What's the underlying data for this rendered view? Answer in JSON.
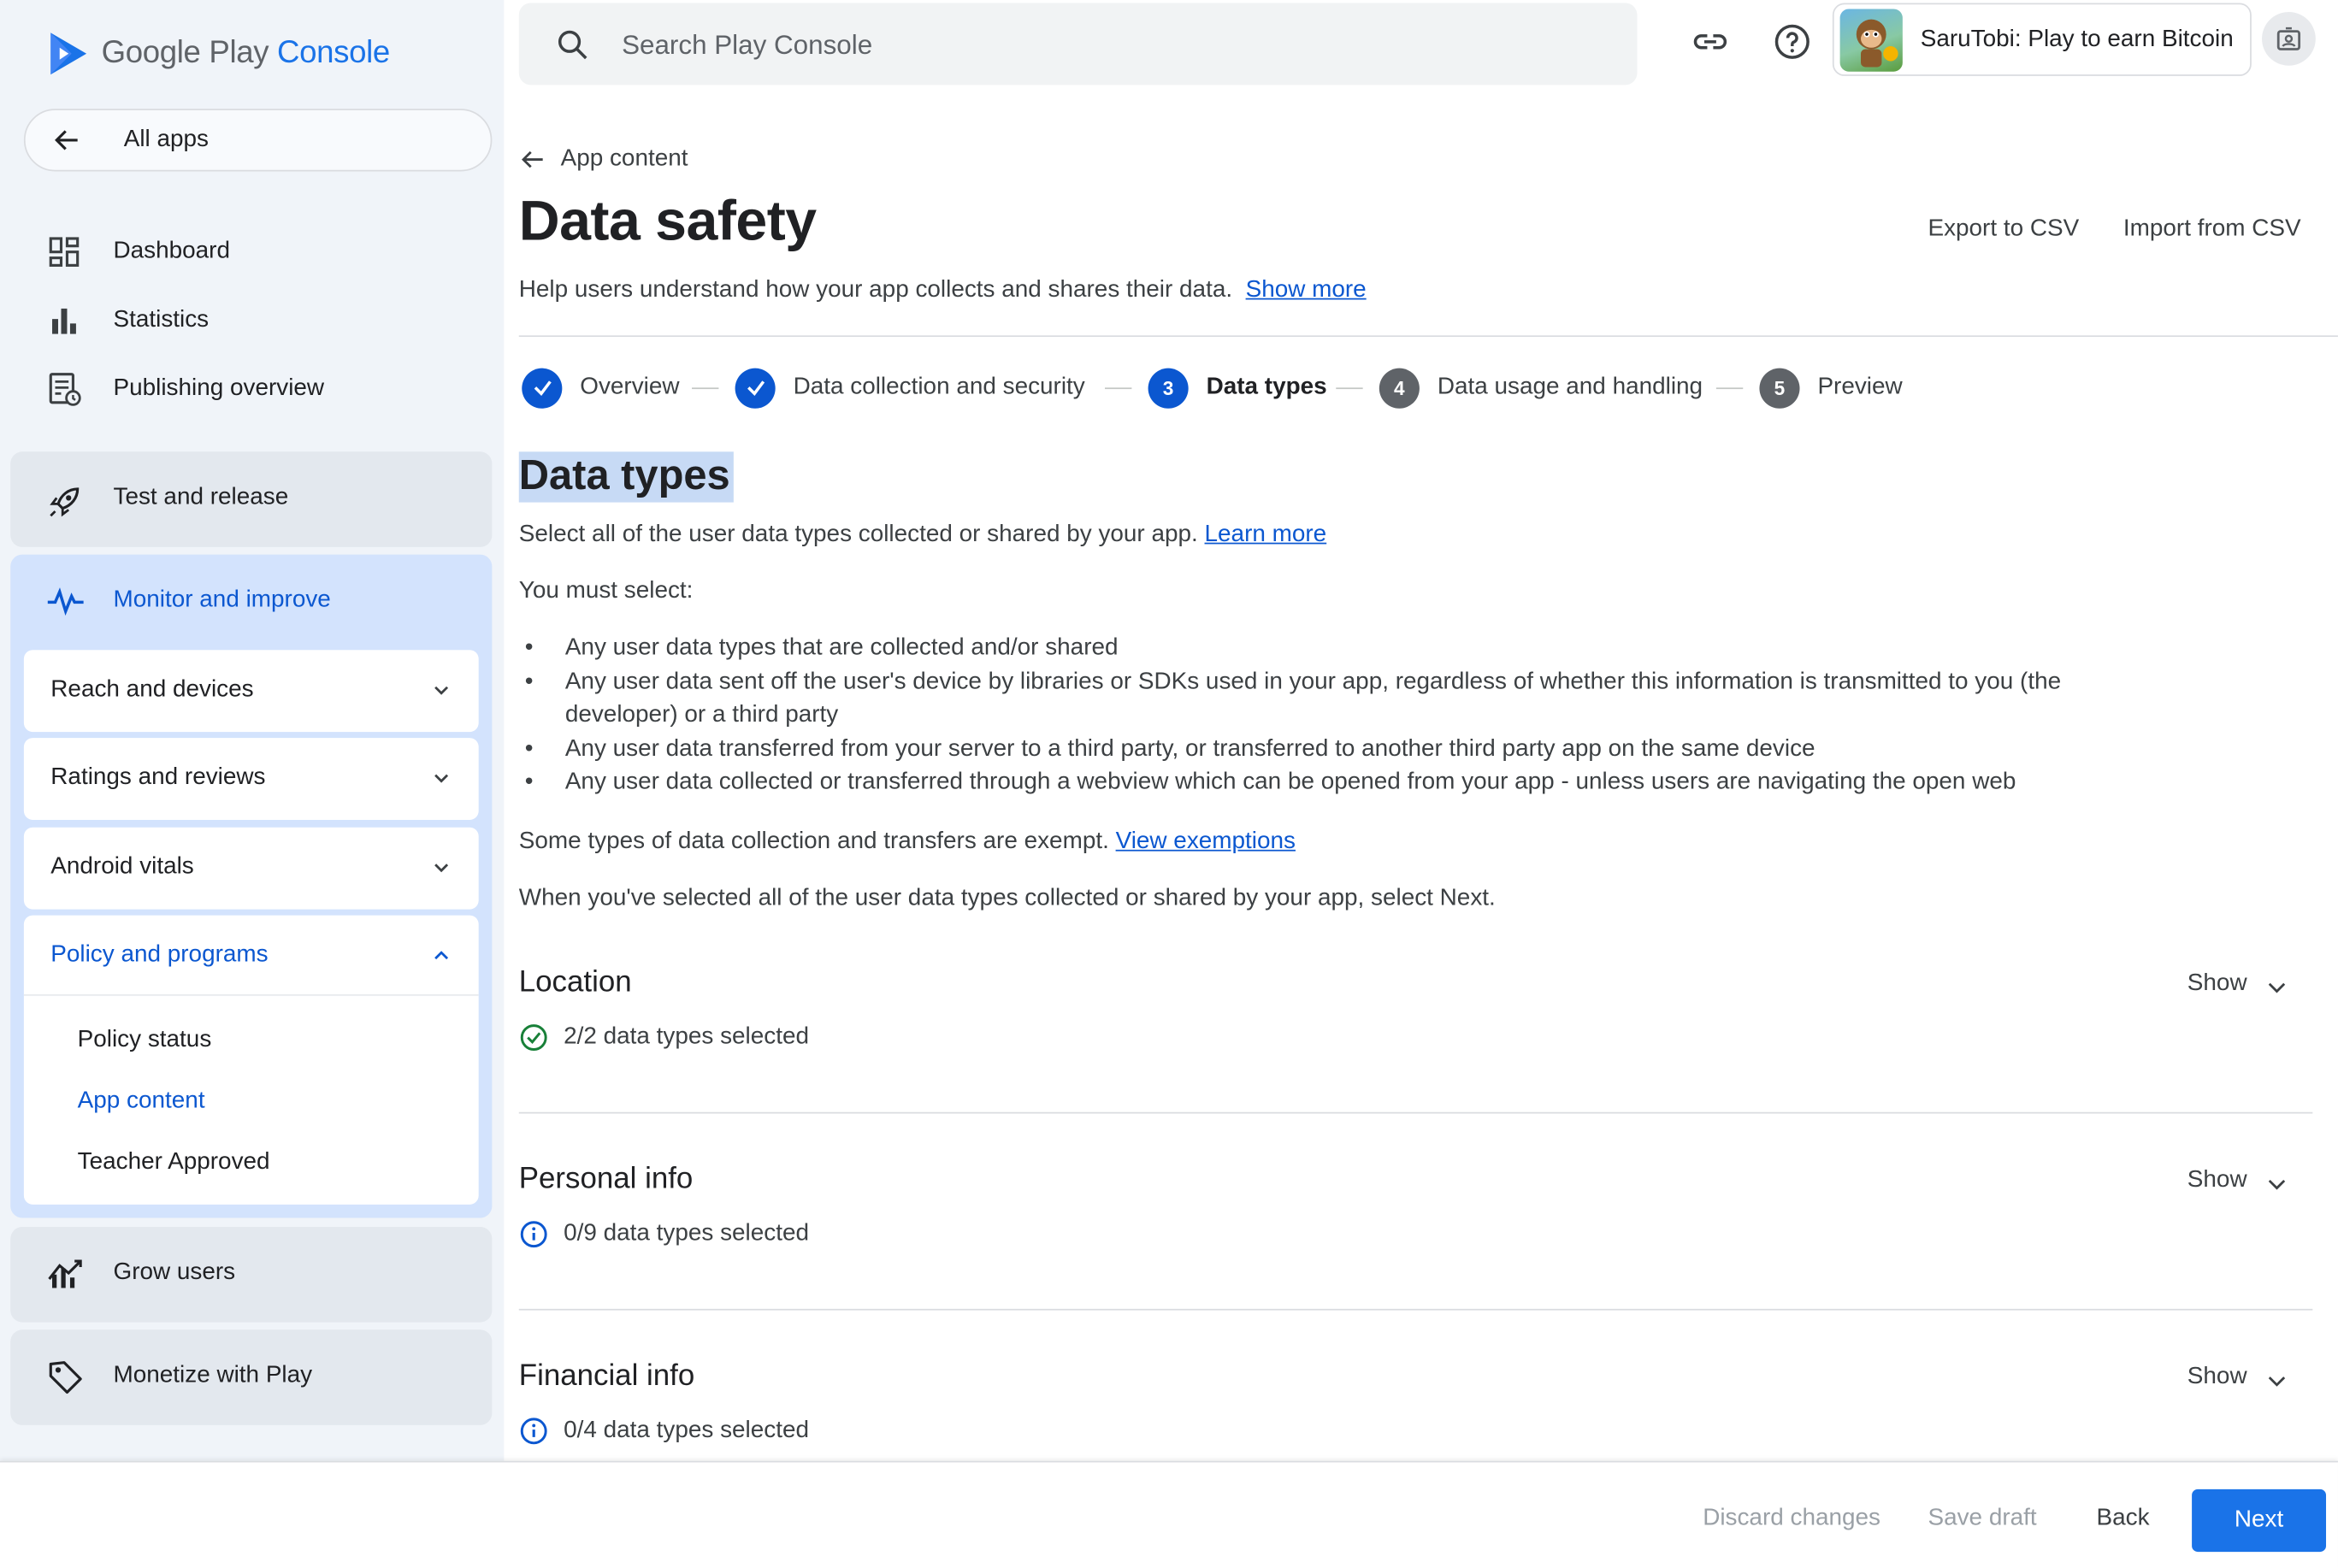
{
  "brand": {
    "name_part1": "Google Play",
    "name_part2": "Console"
  },
  "sidebar": {
    "all_apps": "All apps",
    "items": [
      {
        "label": "Dashboard",
        "icon": "dashboard-icon"
      },
      {
        "label": "Statistics",
        "icon": "bar-chart-icon"
      },
      {
        "label": "Publishing overview",
        "icon": "publishing-icon"
      }
    ],
    "groups": {
      "test_release": "Test and release",
      "monitor": "Monitor and improve",
      "grow": "Grow users",
      "monetize": "Monetize with Play"
    },
    "monitor_subs": [
      {
        "label": "Reach and devices"
      },
      {
        "label": "Ratings and reviews"
      },
      {
        "label": "Android vitals"
      }
    ],
    "policy": {
      "label": "Policy and programs",
      "items": [
        "Policy status",
        "App content",
        "Teacher Approved"
      ]
    }
  },
  "topbar": {
    "search_placeholder": "Search Play Console",
    "app_name": "SaruTobi: Play to earn Bitcoin"
  },
  "page": {
    "back_label": "App content",
    "title": "Data safety",
    "export": "Export to CSV",
    "import": "Import from CSV",
    "description": "Help users understand how your app collects and shares their data.",
    "show_more": "Show more"
  },
  "steps": [
    {
      "num": "1",
      "label": "Overview",
      "state": "done"
    },
    {
      "num": "2",
      "label": "Data collection and security",
      "state": "done"
    },
    {
      "num": "3",
      "label": "Data types",
      "state": "current"
    },
    {
      "num": "4",
      "label": "Data usage and handling",
      "state": "todo"
    },
    {
      "num": "5",
      "label": "Preview",
      "state": "todo"
    }
  ],
  "section": {
    "title": "Data types",
    "intro": "Select all of the user data types collected or shared by your app.",
    "learn_more": "Learn more",
    "must_select": "You must select:",
    "bullets": [
      "Any user data types that are collected and/or shared",
      "Any user data sent off the user's device by libraries or SDKs used in your app, regardless of whether this information is transmitted to you (the developer) or a third party",
      "Any user data transferred from your server to a third party, or transferred to another third party app on the same device",
      "Any user data collected or transferred through a webview which can be opened from your app - unless users are navigating the open web"
    ],
    "exempt": "Some types of data collection and transfers are exempt.",
    "view_exemptions": "View exemptions",
    "next_hint": "When you've selected all of the user data types collected or shared by your app, select Next."
  },
  "categories": [
    {
      "title": "Location",
      "status": "2/2 data types selected",
      "state": "complete",
      "show": "Show"
    },
    {
      "title": "Personal info",
      "status": "0/9 data types selected",
      "state": "info",
      "show": "Show"
    },
    {
      "title": "Financial info",
      "status": "0/4 data types selected",
      "state": "info",
      "show": "Show"
    }
  ],
  "footer": {
    "discard": "Discard changes",
    "save": "Save draft",
    "back": "Back",
    "next": "Next"
  },
  "colors": {
    "accent": "#0b57d0",
    "primary_button": "#1a73e8",
    "success": "#188038",
    "selection": "#c7daf5"
  }
}
